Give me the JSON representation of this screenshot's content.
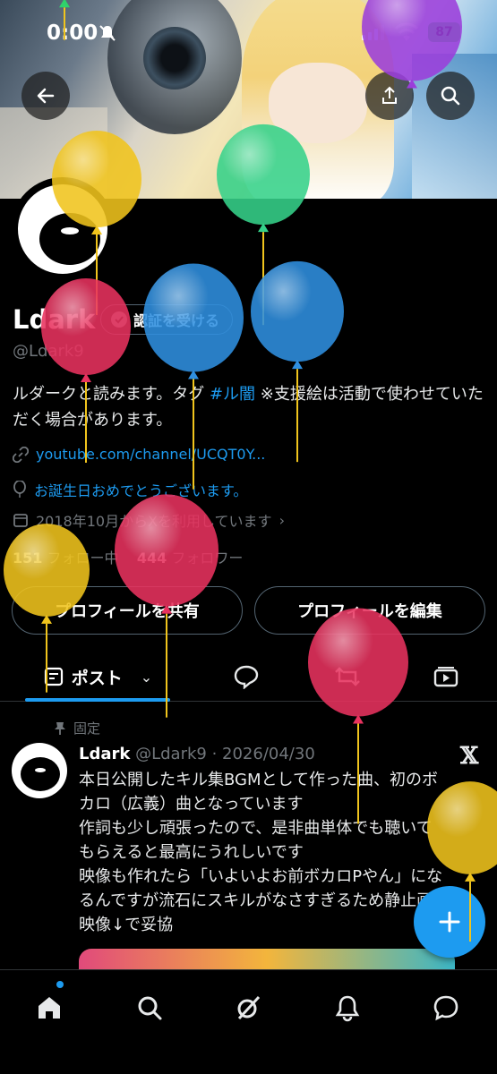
{
  "status_bar": {
    "time": "0:00",
    "battery": "87"
  },
  "profile": {
    "name": "Ldark",
    "verify_label": "認証を受ける",
    "handle": "@Ldark9",
    "bio_prefix": "ルダークと読みます。",
    "bio_tag_label": "タグ",
    "bio_hashtag": "#ル闇",
    "bio_suffix": "※支援絵は活動で使わせていただく場合があります。",
    "link": "youtube.com/channel/UCQT0Y...",
    "birthday": "お誕生日おめでとうございます。",
    "joined": "2018年10月からXを利用しています",
    "following_count": "151",
    "following_label": "フォロー中",
    "followers_count": "444",
    "followers_label": "フォロワー",
    "share_button": "プロフィールを共有",
    "edit_button": "プロフィールを編集"
  },
  "tabs": {
    "posts_label": "ポスト"
  },
  "post": {
    "pinned_label": "固定",
    "author": "Ldark",
    "handle_date": "@Ldark9 · 2026/04/30",
    "lines": [
      "本日公開したキル集BGMとして作った曲、初のボ",
      "カロ（広義）曲となっています",
      "作詞も少し頑張ったので、是非曲単体でも聴いて",
      "もらえると最高にうれしいです",
      "映像も作れたら「いよいよお前ボカロPやん」にな",
      "るんですが流石にスキルがなさすぎるため静止画",
      "映像↓で妥協"
    ]
  },
  "icons": {
    "back": "back-arrow-icon",
    "search": "search-icon",
    "share": "share-icon",
    "compose": "plus-icon",
    "home": "home-icon",
    "explore": "search-icon",
    "grok": "grok-icon",
    "notifications": "bell-icon",
    "messages": "message-icon"
  },
  "colors": {
    "accent": "#1d9bf0",
    "background": "#000000",
    "secondary_text": "#71767b",
    "battery": "#35c759"
  },
  "balloons": [
    {
      "color": "#2fd26b"
    },
    {
      "color": "#9b3ddb"
    },
    {
      "color": "#f0c41d"
    },
    {
      "color": "#35d18a"
    },
    {
      "color": "#e8325f"
    },
    {
      "color": "#2f8fe0"
    },
    {
      "color": "#2f8fe0"
    },
    {
      "color": "#f0c41d"
    },
    {
      "color": "#e8325f"
    },
    {
      "color": "#e8325f"
    },
    {
      "color": "#f0c41d"
    }
  ]
}
